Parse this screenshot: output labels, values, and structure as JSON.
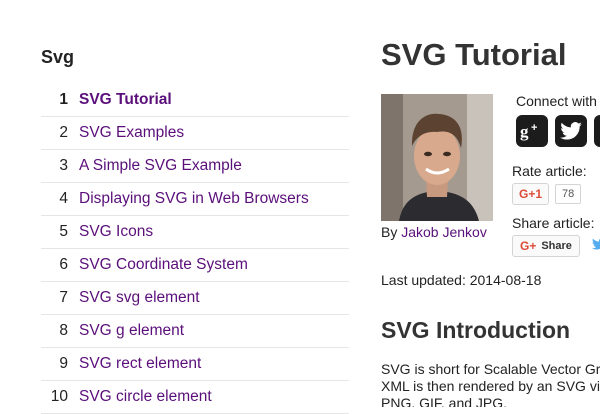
{
  "sidebar": {
    "title": "Svg",
    "items": [
      {
        "num": "1",
        "label": "SVG Tutorial",
        "active": true
      },
      {
        "num": "2",
        "label": "SVG Examples"
      },
      {
        "num": "3",
        "label": "A Simple SVG Example"
      },
      {
        "num": "4",
        "label": "Displaying SVG in Web Browsers"
      },
      {
        "num": "5",
        "label": "SVG Icons"
      },
      {
        "num": "6",
        "label": "SVG Coordinate System"
      },
      {
        "num": "7",
        "label": "SVG svg element"
      },
      {
        "num": "8",
        "label": "SVG g element"
      },
      {
        "num": "9",
        "label": "SVG rect element"
      },
      {
        "num": "10",
        "label": "SVG circle element"
      }
    ]
  },
  "article": {
    "title": "SVG Tutorial",
    "by_prefix": "By",
    "author": "Jakob Jenkov",
    "connect_label": "Connect with",
    "rate_label": "Rate article:",
    "gplus_label": "+1",
    "gplus_count": "78",
    "share_label": "Share article:",
    "share_button": "Share",
    "last_updated": "Last updated: 2014-08-18",
    "section_title": "SVG Introduction",
    "intro_lines": [
      "SVG is short for Scalable Vector Graphics. SVG is an XML language for",
      "XML is then rendered by an SVG viewer. Most modern browsers",
      "PNG, GIF, and JPG."
    ]
  },
  "colors": {
    "link": "#5a0f7a",
    "social_bg": "#1c1c1c",
    "google_red": "#dd4b39",
    "twitter_blue": "#55acee"
  },
  "icons": [
    "google-plus-icon",
    "twitter-icon",
    "facebook-icon"
  ]
}
